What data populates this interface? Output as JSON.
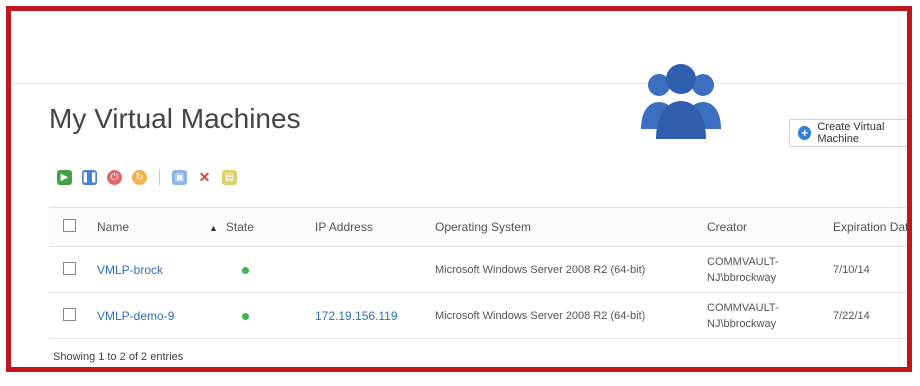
{
  "page": {
    "title": "My Virtual Machines"
  },
  "buttons": {
    "create": "Create Virtual Machine"
  },
  "toolbar": {
    "icons": [
      "start-icon",
      "pause-icon",
      "power-off-icon",
      "restart-icon",
      "console-icon",
      "delete-icon",
      "snapshot-icon"
    ]
  },
  "table": {
    "headers": {
      "name": "Name",
      "state": "State",
      "ip": "IP Address",
      "os": "Operating System",
      "creator": "Creator",
      "expiration": "Expiration Date"
    },
    "rows": [
      {
        "name": "VMLP-brock",
        "state": "running",
        "ip": "",
        "os": "Microsoft Windows Server 2008 R2 (64-bit)",
        "creator_line1": "COMMVAULT-",
        "creator_line2": "NJ\\bbrockway",
        "expiration": "7/10/14"
      },
      {
        "name": "VMLP-demo-9",
        "state": "running",
        "ip": "172.19.156.119",
        "os": "Microsoft Windows Server 2008 R2 (64-bit)",
        "creator_line1": "COMMVAULT-",
        "creator_line2": "NJ\\bbrockway",
        "expiration": "7/22/14"
      }
    ]
  },
  "footer": {
    "entries": "Showing 1 to 2 of 2 entries"
  },
  "colors": {
    "frame": "#c3151c",
    "accent": "#2f7fd8",
    "link": "#2d6fb8",
    "running": "#3bb54a"
  }
}
